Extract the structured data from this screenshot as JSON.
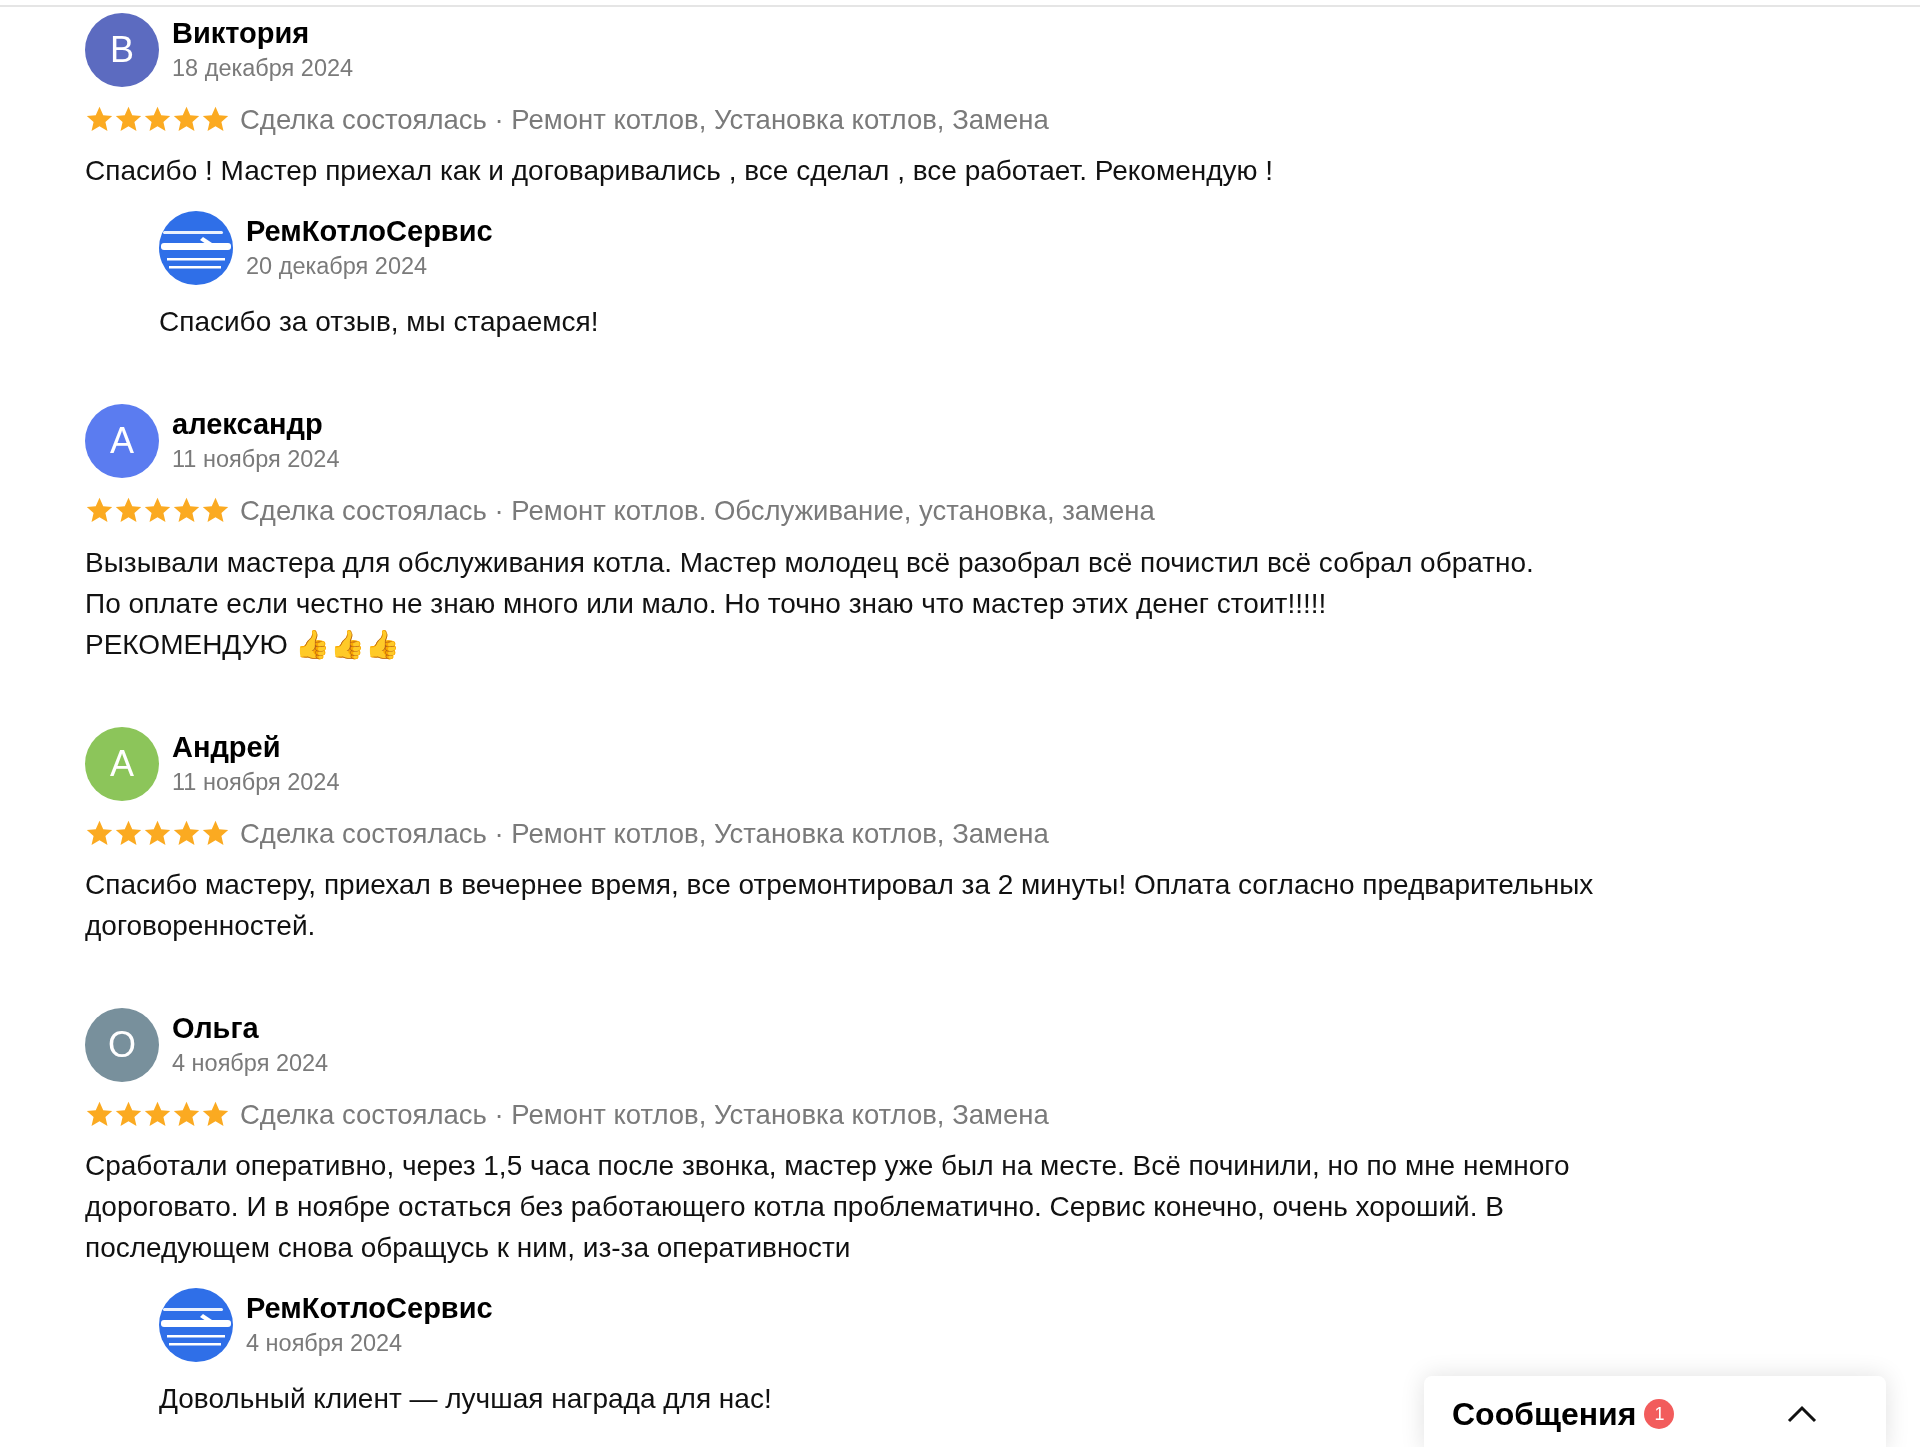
{
  "reviews": [
    {
      "initial": "В",
      "color": "#5c6bc0",
      "author": "Виктория",
      "date": "18 декабря 2024",
      "stars": 5,
      "tags": "Сделка состоялась · Ремонт котлов, Установка котлов, Замена",
      "text": "Спасибо ! Мастер приехал как и договаривались , все сделал , все работает. Рекомендую !",
      "reply": {
        "author": "РемКотлоСервис",
        "date": "20 декабря 2024",
        "text": "Спасибо за отзыв, мы стараемся!"
      }
    },
    {
      "initial": "А",
      "color": "#5b7cf0",
      "author": "александр",
      "date": "11 ноября 2024",
      "stars": 5,
      "tags": "Сделка состоялась · Ремонт котлов. Обслуживание, установка, замена",
      "text": "Вызывали мастера для обслуживания котла. Мастер молодец всё разобрал всё почистил всё собрал обратно.\nПо оплате если честно не знаю много или мало. Но точно знаю что мастер этих денег стоит!!!!!\nРЕКОМЕНДУЮ 👍👍👍"
    },
    {
      "initial": "А",
      "color": "#8cc55a",
      "author": "Андрей",
      "date": "11 ноября 2024",
      "stars": 5,
      "tags": "Сделка состоялась · Ремонт котлов, Установка котлов, Замена",
      "text": "Спасибо мастеру, приехал в вечернее время, все отремонтировал за 2 минуты! Оплата согласно предварительных договоренностей."
    },
    {
      "initial": "О",
      "color": "#78909c",
      "author": "Ольга",
      "date": "4 ноября 2024",
      "stars": 5,
      "tags": "Сделка состоялась · Ремонт котлов, Установка котлов, Замена",
      "text": "Сработали оперативно, через 1,5 часа после звонка, мастер уже был на месте. Всё починили, но по мне немного дороговато. И в ноябре остаться без работающего котла проблематично. Сервис конечно, очень хороший. В последующем снова обращусь к ним, из-за оперативности",
      "reply": {
        "author": "РемКотлоСервис",
        "date": "4 ноября 2024",
        "text": "Довольный клиент — лучшая награда для нас!"
      }
    }
  ],
  "messages": {
    "title": "Сообщения",
    "badge": "1"
  }
}
